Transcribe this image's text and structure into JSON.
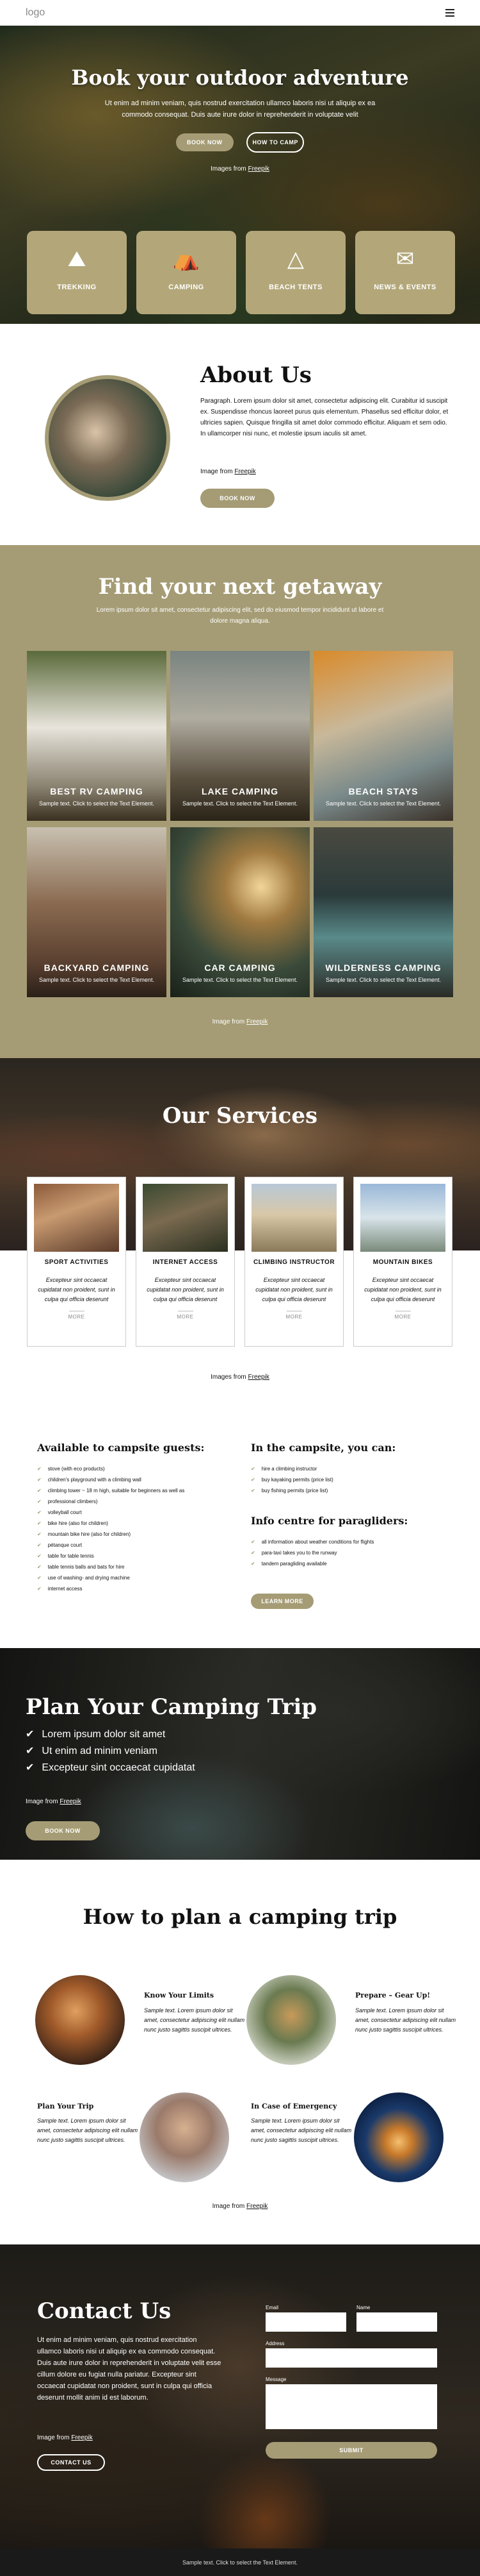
{
  "header": {
    "logo": "logo"
  },
  "hero": {
    "title": "Book your outdoor adventure",
    "lead": "Ut enim ad minim veniam, quis nostrud exercitation ullamco laboris nisi ut aliquip ex ea commodo consequat. Duis aute irure dolor in reprehenderit in voluptate velit",
    "btn_book": "BOOK NOW",
    "btn_camp": "HOW TO CAMP",
    "caption": "Images from",
    "caption_link": "Freepik",
    "features": [
      {
        "label": "TREKKING",
        "icon": "trekking-icon"
      },
      {
        "label": "CAMPING",
        "icon": "camping-icon"
      },
      {
        "label": "BEACH TENTS",
        "icon": "beach-tent-icon"
      },
      {
        "label": "NEWS & EVENTS",
        "icon": "news-events-icon"
      }
    ]
  },
  "about": {
    "title": "About Us",
    "text": "Paragraph. Lorem ipsum dolor sit amet, consectetur adipiscing elit. Curabitur id suscipit ex. Suspendisse rhoncus laoreet purus quis elementum. Phasellus sed efficitur dolor, et ultricies sapien. Quisque fringilla sit amet dolor commodo efficitur. Aliquam et sem odio. In ullamcorper nisi nunc, et molestie ipsum iaculis sit amet.",
    "caption": "Image from",
    "caption_link": "Freepik",
    "btn": "BOOK NOW"
  },
  "getaway": {
    "title": "Find your next getaway",
    "text": "Lorem ipsum dolor sit amet, consectetur adipiscing elit, sed do eiusmod tempor incididunt ut labore et dolore magna aliqua.",
    "cards": [
      {
        "title": "BEST RV CAMPING",
        "sub": "Sample text. Click to select the Text Element."
      },
      {
        "title": "LAKE CAMPING",
        "sub": "Sample text. Click to select the Text Element."
      },
      {
        "title": "BEACH STAYS",
        "sub": "Sample text. Click to select the Text Element."
      },
      {
        "title": "BACKYARD CAMPING",
        "sub": "Sample text. Click to select the Text Element."
      },
      {
        "title": "CAR CAMPING",
        "sub": "Sample text. Click to select the Text Element."
      },
      {
        "title": "WILDERNESS CAMPING",
        "sub": "Sample text. Click to select the Text Element."
      }
    ],
    "caption": "Image from",
    "caption_link": "Freepik"
  },
  "services": {
    "title": "Our Services",
    "cards": [
      {
        "title": "SPORT ACTIVITIES",
        "desc": "Excepteur sint occaecat cupidatat non proident, sunt in culpa qui officia deserunt",
        "more": "MORE"
      },
      {
        "title": "INTERNET ACCESS",
        "desc": "Excepteur sint occaecat cupidatat non proident, sunt in culpa qui officia deserunt",
        "more": "MORE"
      },
      {
        "title": "CLIMBING INSTRUCTOR",
        "desc": "Excepteur sint occaecat cupidatat non proident, sunt in culpa qui officia deserunt",
        "more": "MORE"
      },
      {
        "title": "MOUNTAIN BIKES",
        "desc": "Excepteur sint occaecat cupidatat non proident, sunt in culpa qui officia deserunt",
        "more": "MORE"
      }
    ],
    "caption": "Images from",
    "caption_link": "Freepik"
  },
  "camp": {
    "left_title": "Available to campsite guests:",
    "left_items": [
      "stove (with eco products)",
      "children's playground with a climbing wall",
      "climbing tower ~ 18 m high, suitable for beginners as well as",
      "professional climbers)",
      "volleyball court",
      "bike hire (also for children)",
      "mountain bike hire (also for children)",
      "pétanque court",
      "table for table tennis",
      "table tennis balls and bats for hire",
      "use of washing- and drying machine",
      "internet access"
    ],
    "right_title": "In the campsite, you can:",
    "right_items": [
      "hire a climbing instructor",
      "buy kayaking permits (price list)",
      "buy fishing permits (price list)"
    ],
    "right_title2": "Info centre for paragliders:",
    "right_items2": [
      "all information about weather conditions for flights",
      "para-taxi takes you to the runway",
      "tandem paragliding available"
    ],
    "btn": "LEARN MORE"
  },
  "plan": {
    "title": "Plan Your Camping Trip",
    "items": [
      "Lorem ipsum dolor sit amet",
      "Ut enim ad minim veniam",
      "Excepteur sint occaecat cupidatat"
    ],
    "caption": "Image from",
    "caption_link": "Freepik",
    "btn": "BOOK NOW"
  },
  "how": {
    "title": "How to plan a camping trip",
    "steps": [
      {
        "title": "Know Your Limits",
        "text": "Sample text. Lorem ipsum dolor sit amet, consectetur adipiscing elit nullam nunc justo sagittis suscipit ultrices."
      },
      {
        "title": "Prepare – Gear Up!",
        "text": "Sample text. Lorem ipsum dolor sit amet, consectetur adipiscing elit nullam nunc justo sagittis suscipit ultrices."
      },
      {
        "title": "Plan Your Trip",
        "text": "Sample text. Lorem ipsum dolor sit amet, consectetur adipiscing elit nullam nunc justo sagittis suscipit ultrices."
      },
      {
        "title": "In Case of Emergency",
        "text": "Sample text. Lorem ipsum dolor sit amet, consectetur adipiscing elit nullam nunc justo sagittis suscipit ultrices."
      }
    ],
    "caption": "Image from",
    "caption_link": "Freepik"
  },
  "contact": {
    "title": "Contact Us",
    "text": "Ut enim ad minim veniam, quis nostrud exercitation ullamco laboris nisi ut aliquip ex ea commodo consequat. Duis aute irure dolor in reprehenderit in voluptate velit esse cillum dolore eu fugiat nulla pariatur. Excepteur sint occaecat cupidatat non proident, sunt in culpa qui officia deserunt mollit anim id est laborum.",
    "caption": "Image from",
    "caption_link": "Freepik",
    "btn": "CONTACT US",
    "email_label": "Email",
    "name_label": "Name",
    "address_label": "Address",
    "message_label": "Message",
    "submit": "SUBMIT"
  },
  "footer": {
    "text": "Sample text. Click to select the Text Element."
  },
  "colors": {
    "accent": "#a59c75",
    "dark": "#1a1a1a"
  }
}
